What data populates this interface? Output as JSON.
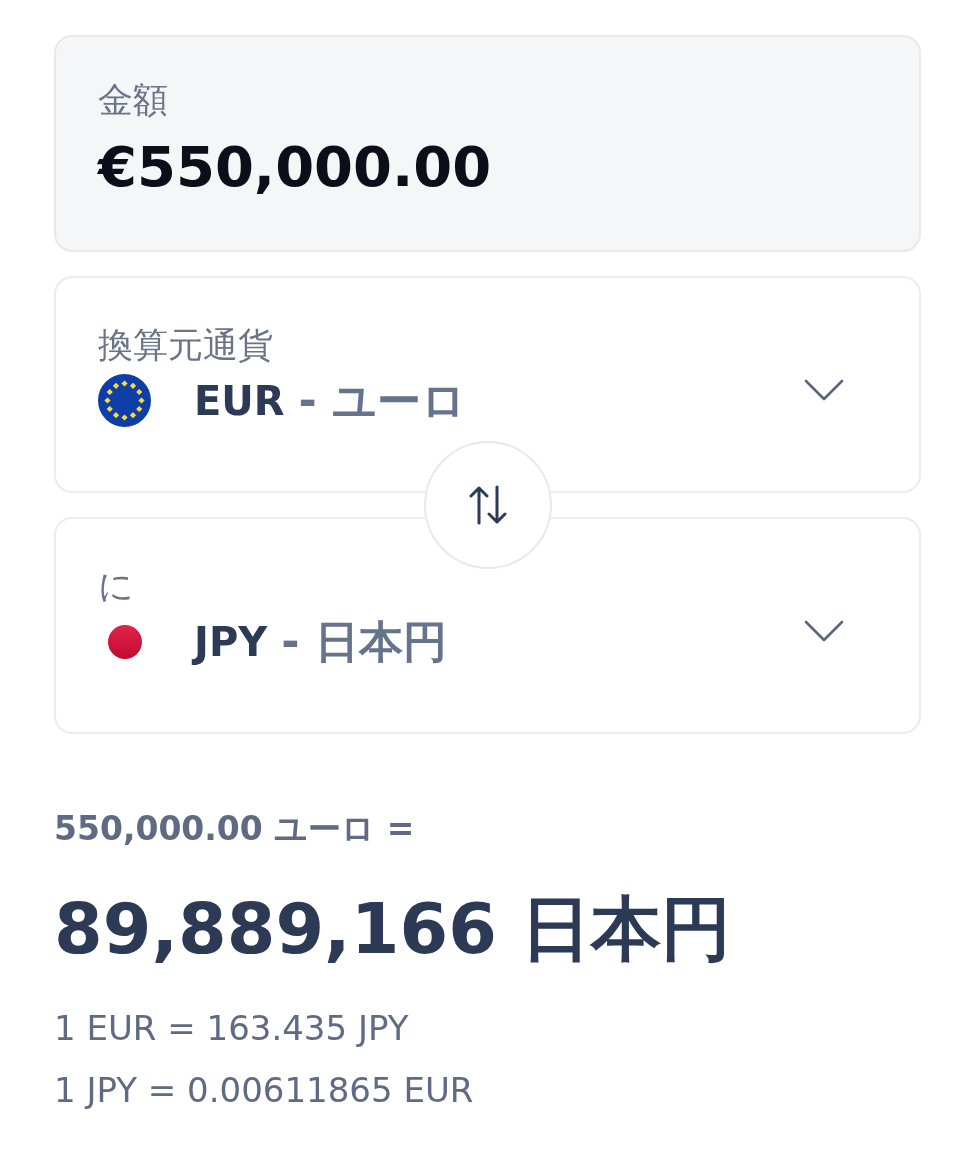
{
  "amount": {
    "label": "金額",
    "value": "€550,000.00"
  },
  "currencies": [
    {
      "label": "換算元通貨",
      "kind": "eu",
      "code": "EUR",
      "name": "- ユーロ"
    },
    {
      "label": "に",
      "kind": "jp",
      "code": "JPY",
      "name": "- 日本円"
    }
  ],
  "result": {
    "source": "550,000.00 ユーロ =",
    "converted": "89,889,166 日本円",
    "rates": [
      "1 EUR = 163.435 JPY",
      "1 JPY = 0.00611865 EUR"
    ]
  }
}
